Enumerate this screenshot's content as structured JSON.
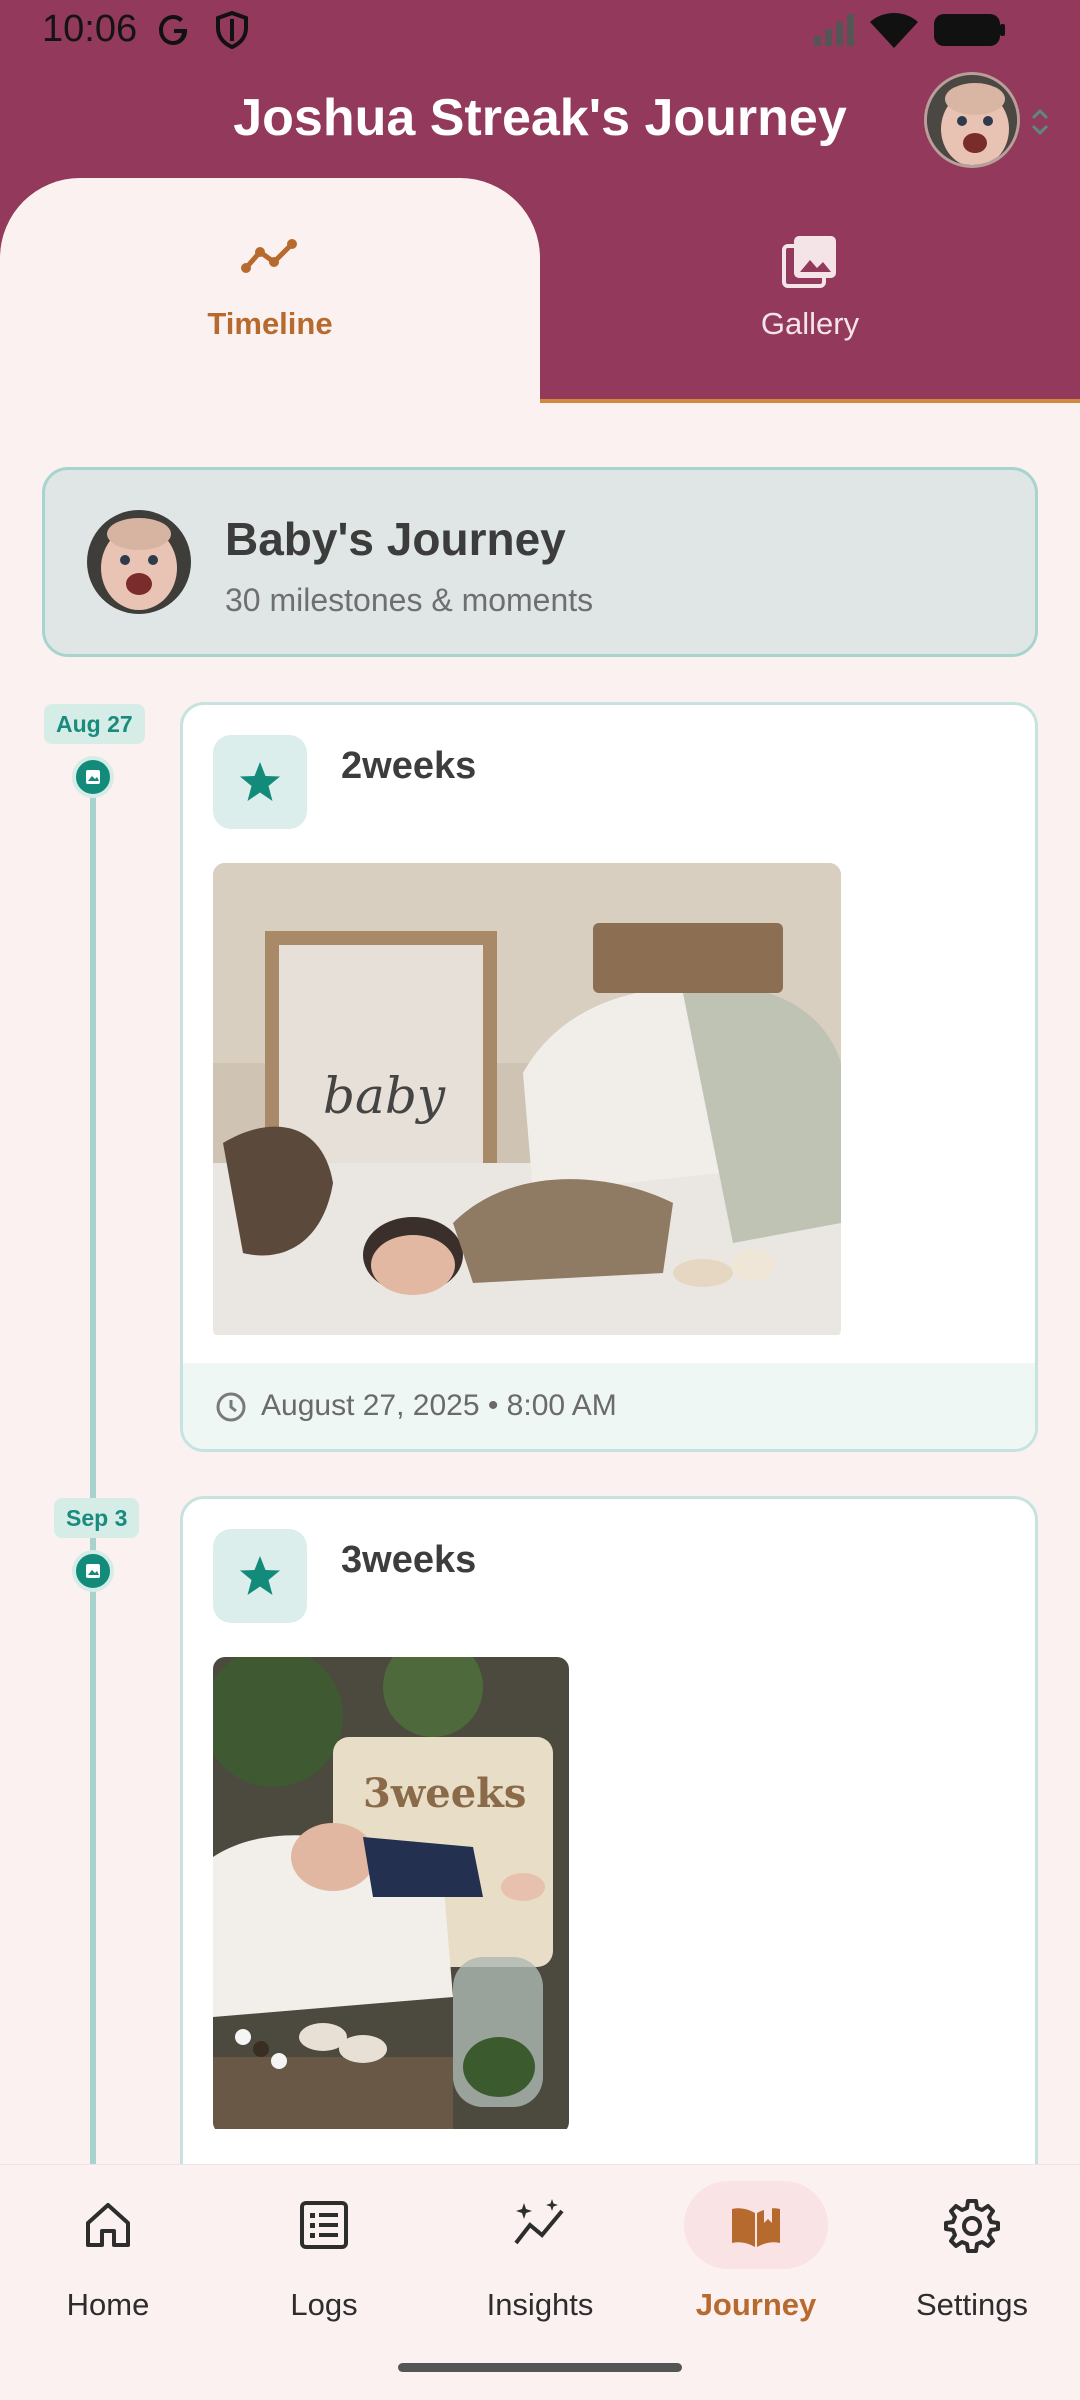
{
  "status_bar": {
    "time": "10:06"
  },
  "header": {
    "title": "Joshua Streak's Journey"
  },
  "tabs": [
    {
      "label": "Timeline",
      "active": true,
      "icon": "timeline-chart-icon"
    },
    {
      "label": "Gallery",
      "active": false,
      "icon": "photo-library-icon"
    }
  ],
  "summary": {
    "title": "Baby's Journey",
    "subtitle": "30 milestones & moments"
  },
  "entries": [
    {
      "date_badge": "Aug 27",
      "title": "2weeks",
      "icon": "star-icon",
      "timestamp": "August 27, 2025 • 8:00 AM"
    },
    {
      "date_badge": "Sep 3",
      "title": "3weeks",
      "icon": "star-icon"
    }
  ],
  "bottom_nav": [
    {
      "label": "Home",
      "icon": "home-icon"
    },
    {
      "label": "Logs",
      "icon": "list-icon"
    },
    {
      "label": "Insights",
      "icon": "insights-icon"
    },
    {
      "label": "Journey",
      "icon": "book-icon",
      "active": true
    },
    {
      "label": "Settings",
      "icon": "gear-icon"
    }
  ],
  "colors": {
    "header": "#93395b",
    "accent": "#b76a2d",
    "teal": "#128b7a",
    "background": "#fcf1f1"
  }
}
